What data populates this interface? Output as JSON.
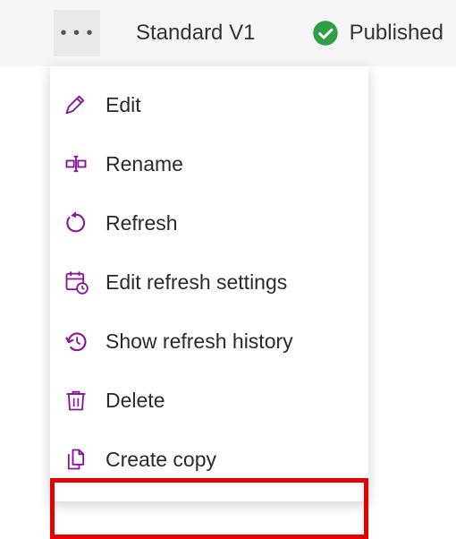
{
  "topbar": {
    "title": "Standard V1",
    "status_label": "Published"
  },
  "menu": {
    "items": [
      {
        "label": "Edit",
        "icon": "edit-icon"
      },
      {
        "label": "Rename",
        "icon": "rename-icon"
      },
      {
        "label": "Refresh",
        "icon": "refresh-icon"
      },
      {
        "label": "Edit refresh settings",
        "icon": "calendar-settings-icon"
      },
      {
        "label": "Show refresh history",
        "icon": "history-icon"
      },
      {
        "label": "Delete",
        "icon": "delete-icon"
      },
      {
        "label": "Create copy",
        "icon": "copy-icon"
      }
    ]
  },
  "colors": {
    "accent": "#881798",
    "success": "#2f9e44",
    "highlight": "#e60000"
  }
}
